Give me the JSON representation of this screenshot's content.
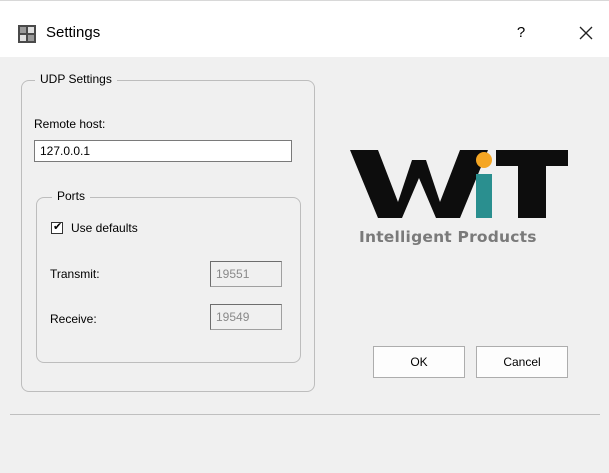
{
  "window": {
    "title": "Settings",
    "help_label": "?",
    "app_icon": "settings-app-icon",
    "close_icon": "close-icon"
  },
  "udp_settings": {
    "group_label": "UDP Settings",
    "remote_host_label": "Remote host:",
    "remote_host_value": "127.0.0.1",
    "ports": {
      "group_label": "Ports",
      "use_defaults_label": "Use defaults",
      "use_defaults_checked": true,
      "transmit_label": "Transmit:",
      "transmit_value": "19551",
      "receive_label": "Receive:",
      "receive_value": "19549"
    }
  },
  "logo": {
    "text": "WiT",
    "tagline": "Intelligent Products",
    "dot_color": "#f5a623",
    "i_color": "#2a8f8f",
    "letter_color": "#0d0d0d"
  },
  "buttons": {
    "ok_label": "OK",
    "cancel_label": "Cancel"
  },
  "colors": {
    "background": "#f0f0f0",
    "titlebar": "#ffffff"
  }
}
